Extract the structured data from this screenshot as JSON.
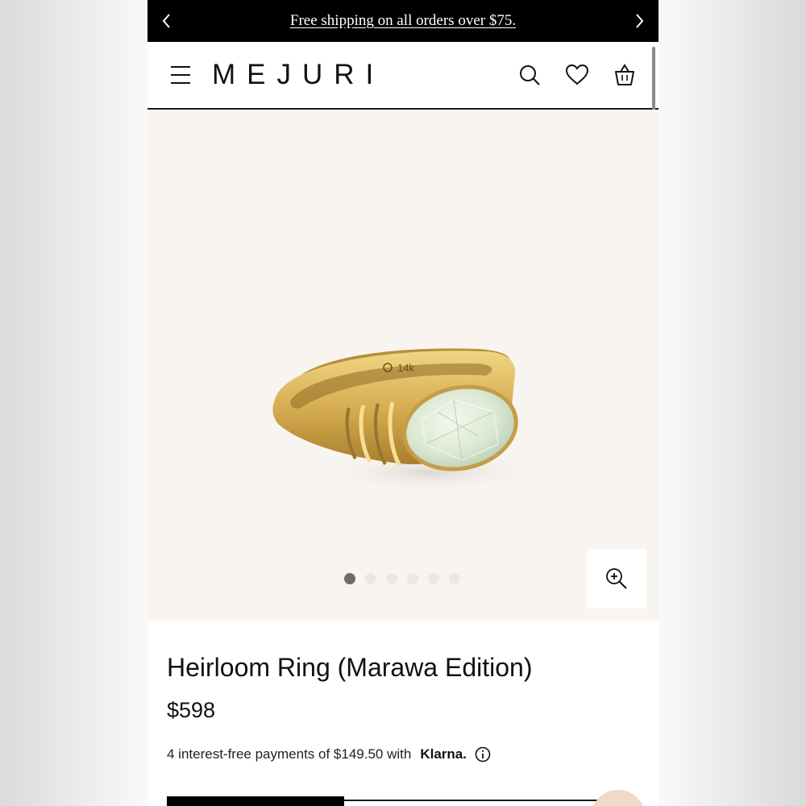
{
  "promo_bar": {
    "text": "Free shipping on all orders over $75."
  },
  "header": {
    "logo": "MEJURI",
    "icons": [
      "menu-icon",
      "search-icon",
      "heart-icon",
      "shopping-bag-icon"
    ]
  },
  "gallery": {
    "image_count": 6,
    "active_index": 0,
    "ring_engraving": "14k"
  },
  "product": {
    "title": "Heirloom Ring (Marawa Edition)",
    "price": "$598",
    "payment_text": "4 interest-free payments of $149.50 with",
    "payment_brand": "Klarna."
  },
  "colors": {
    "promo_bg": "#000000",
    "hero_bg": "#f8f5f1",
    "gold": "#d9b45a",
    "stone": "#dbe8d2",
    "chat_bubble": "#efd9c7"
  }
}
